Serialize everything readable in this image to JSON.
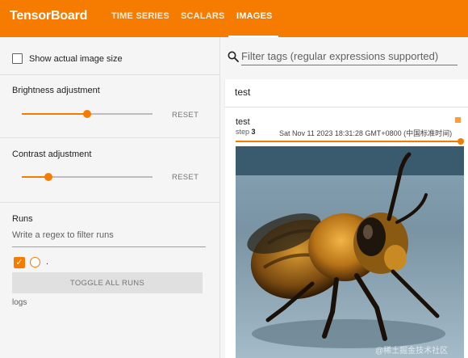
{
  "app": {
    "title": "TensorBoard",
    "accent_color": "#f57c00",
    "tabs": [
      {
        "label": "TIME SERIES",
        "active": false
      },
      {
        "label": "SCALARS",
        "active": false
      },
      {
        "label": "IMAGES",
        "active": true
      }
    ]
  },
  "sidebar": {
    "show_actual_size_label": "Show actual image size",
    "show_actual_size_checked": false,
    "brightness": {
      "label": "Brightness adjustment",
      "reset_label": "RESET",
      "level_fraction": 0.5
    },
    "contrast": {
      "label": "Contrast adjustment",
      "reset_label": "RESET",
      "level_fraction": 0.2
    },
    "runs": {
      "heading": "Runs",
      "filter_placeholder": "Write a regex to filter runs",
      "run_name": ".",
      "run_checked": true,
      "toggle_label": "TOGGLE ALL RUNS",
      "footer": "logs"
    }
  },
  "main": {
    "search_placeholder": "Filter tags (regular expressions supported)",
    "search_icon": "search-icon",
    "group_title": "test",
    "card": {
      "title": "test",
      "step_label": "step",
      "step_value": "3",
      "timestamp": "Sat Nov 11 2023 18:31:28 GMT+0800 (中国标准时间)",
      "image_subject": "bee"
    }
  },
  "watermark": "@稀土掘金技术社区"
}
